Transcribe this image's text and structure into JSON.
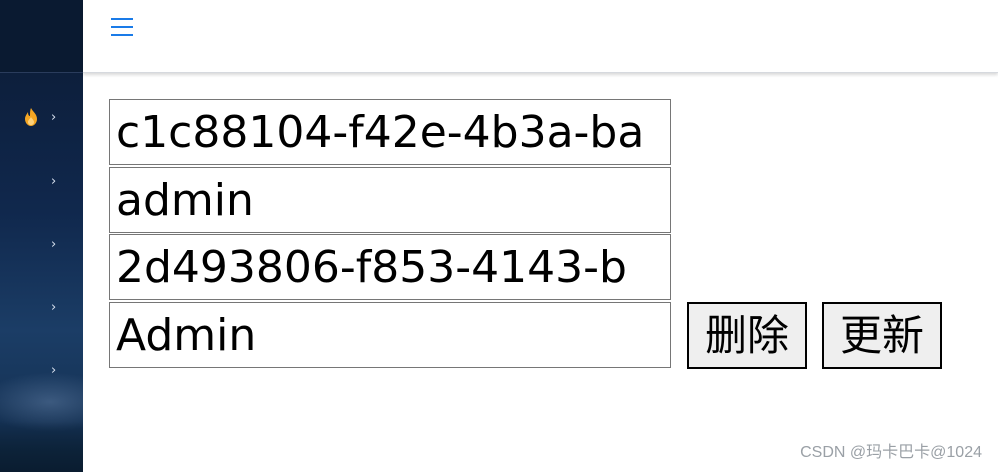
{
  "sidebar": {
    "items": [
      {
        "icon": "flame-icon",
        "chevron": "›"
      },
      {
        "icon": "",
        "chevron": "›"
      },
      {
        "icon": "",
        "chevron": "›"
      },
      {
        "icon": "",
        "chevron": "›"
      },
      {
        "icon": "",
        "chevron": "›"
      }
    ],
    "colors": {
      "background": "#10284d",
      "flame": "#f5a623"
    }
  },
  "header": {
    "menu_icon": "hamburger-icon",
    "accent": "#1a7be8"
  },
  "form": {
    "id_value": "c1c88104-f42e-4b3a-ba",
    "username_value": "admin",
    "uuid_value": "2d493806-f853-4143-b",
    "role_value": "Admin",
    "delete_label": "删除",
    "update_label": "更新"
  },
  "watermark": "CSDN @玛卡巴卡@1024"
}
